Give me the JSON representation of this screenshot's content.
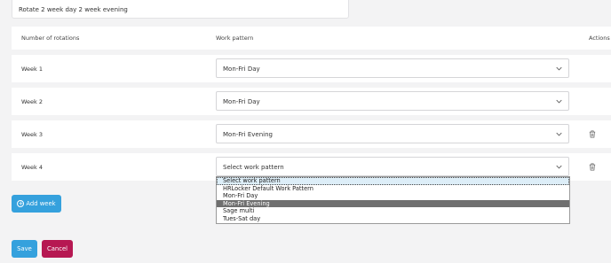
{
  "form": {
    "pattern_name": "Rotate 2 week day 2 week evening"
  },
  "table": {
    "headers": {
      "rotations": "Number of rotations",
      "pattern": "Work pattern",
      "actions": "Actions"
    },
    "rows": [
      {
        "week": "Week 1",
        "pattern": "Mon-Fri Day",
        "deletable": false
      },
      {
        "week": "Week 2",
        "pattern": "Mon-Fri Day",
        "deletable": false
      },
      {
        "week": "Week 3",
        "pattern": "Mon-Fri Evening",
        "deletable": true
      },
      {
        "week": "Week 4",
        "pattern": "Select work pattern",
        "deletable": true
      }
    ]
  },
  "dropdown": {
    "options": [
      "Select work pattern",
      "HRLocker Default Work Pattern",
      "Mon-Fri Day",
      "Mon-Fri Evening",
      "Sage multi",
      "Tues-Sat day"
    ],
    "selected_index": 0,
    "hovered_index": 3
  },
  "buttons": {
    "add_week": "Add week",
    "save": "Save",
    "cancel": "Cancel"
  },
  "colors": {
    "primary": "#35a1dd",
    "danger": "#b61852",
    "hover": "#6f6f6f"
  },
  "icons": {
    "select_caret": "chevron-down-icon",
    "delete": "trash-icon",
    "add": "plus-circle-icon"
  }
}
